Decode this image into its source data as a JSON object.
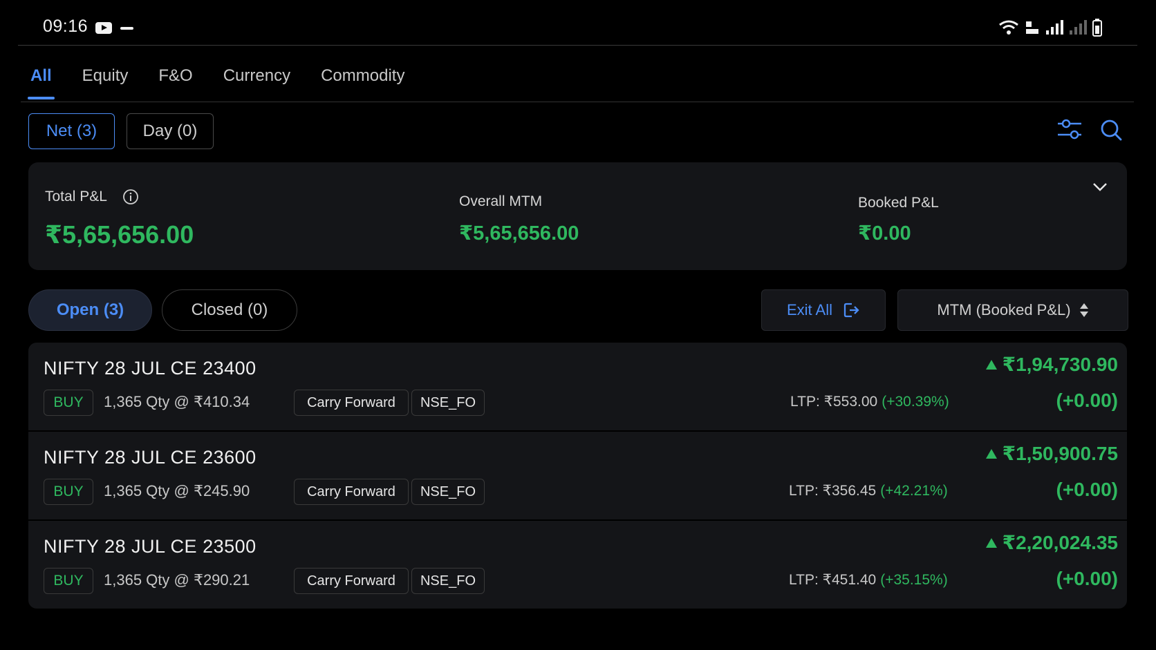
{
  "status_bar": {
    "time": "09:16"
  },
  "tabs": [
    {
      "label": "All"
    },
    {
      "label": "Equity"
    },
    {
      "label": "F&O"
    },
    {
      "label": "Currency"
    },
    {
      "label": "Commodity"
    }
  ],
  "segment": {
    "net_label": "Net (3)",
    "day_label": "Day (0)"
  },
  "summary": {
    "total_pnl_label": "Total P&L",
    "total_pnl_value": "₹5,65,656.00",
    "overall_mtm_label": "Overall MTM",
    "overall_mtm_value": "₹5,65,656.00",
    "booked_pnl_label": "Booked P&L",
    "booked_pnl_value": "₹0.00"
  },
  "filters": {
    "open_label": "Open (3)",
    "closed_label": "Closed (0)",
    "exit_all_label": "Exit All",
    "sort_label": "MTM (Booked P&L)"
  },
  "positions": [
    {
      "name": "NIFTY 28 JUL CE 23400",
      "side": "BUY",
      "qty": "1,365 Qty @ ₹410.34",
      "product": "Carry Forward",
      "exchange": "NSE_FO",
      "ltp": "LTP: ₹553.00",
      "ltp_change": "(+30.39%)",
      "pnl": "₹1,94,730.90",
      "pnl_change": "(+0.00)"
    },
    {
      "name": "NIFTY 28 JUL CE 23600",
      "side": "BUY",
      "qty": "1,365 Qty @ ₹245.90",
      "product": "Carry Forward",
      "exchange": "NSE_FO",
      "ltp": "LTP: ₹356.45",
      "ltp_change": "(+42.21%)",
      "pnl": "₹1,50,900.75",
      "pnl_change": "(+0.00)"
    },
    {
      "name": "NIFTY 28 JUL CE 23500",
      "side": "BUY",
      "qty": "1,365 Qty @ ₹290.21",
      "product": "Carry Forward",
      "exchange": "NSE_FO",
      "ltp": "LTP: ₹451.40",
      "ltp_change": "(+35.15%)",
      "pnl": "₹2,20,024.35",
      "pnl_change": "(+0.00)"
    }
  ],
  "colors": {
    "accent": "#4c8df6",
    "profit": "#2fb85f",
    "card": "#141518"
  }
}
